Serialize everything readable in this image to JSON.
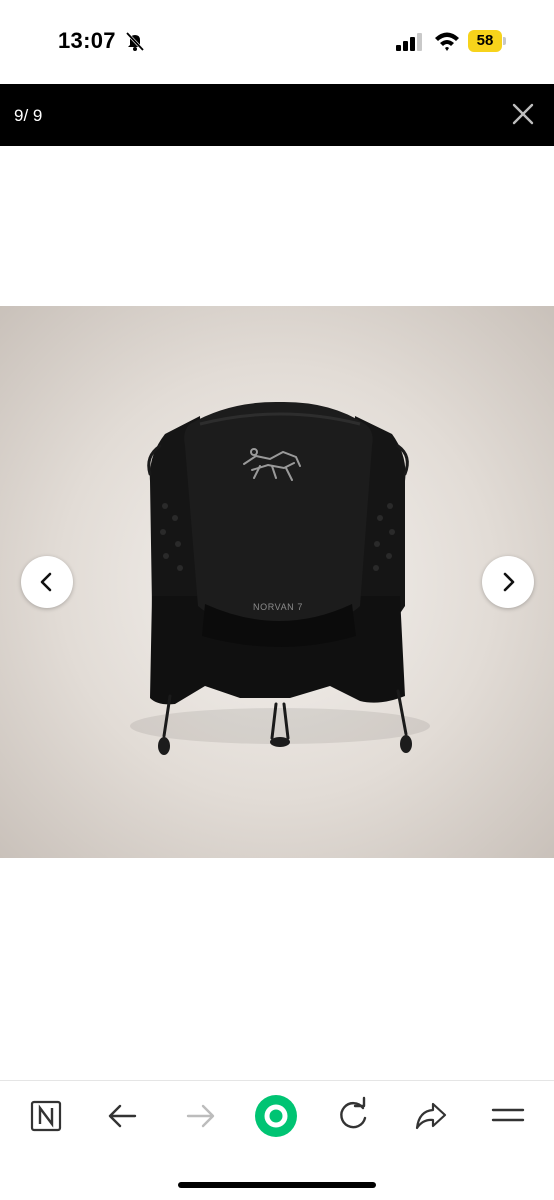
{
  "status_bar": {
    "time": "13:07",
    "battery_level": "58",
    "battery_color": "#f7d31b",
    "icons": [
      "mute-icon",
      "signal-icon",
      "wifi-icon",
      "battery-icon"
    ]
  },
  "viewer": {
    "page_counter": "9/ 9",
    "close_icon": "close-icon",
    "prev_icon": "chevron-left-icon",
    "next_icon": "chevron-right-icon"
  },
  "product": {
    "label_text": "NORVAN 7",
    "logo": "arcteryx-logo"
  },
  "toolbar": {
    "items": [
      "notion-icon",
      "back-arrow-icon",
      "forward-arrow-icon",
      "home-circle-icon",
      "reload-icon",
      "share-icon",
      "menu-icon"
    ],
    "accent_color": "#00c473"
  }
}
